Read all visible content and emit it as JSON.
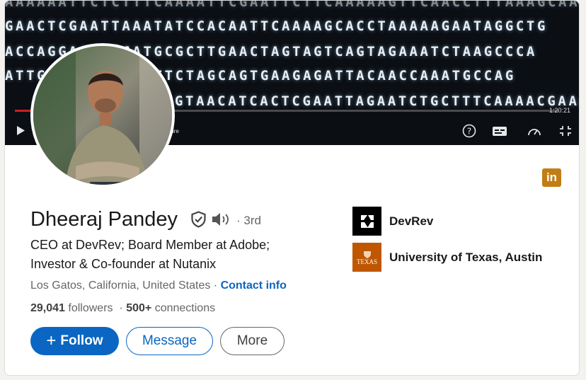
{
  "banner": {
    "dna_rows": [
      "AAAAAATTCTCTTTCAAAATTCGAATTCTTCAAAAAGTTCAACCTTTAAAGCAAAACGGTT",
      "GAACTCGAATTAAATATCCACAATTCAAAAGCACCTAAAAAGAATAGGCTG",
      "ACCAGGAATTTCATGCGCTTGAACTAGTAGTCAGTAGAAATCTAAGCCCA",
      "ATTGCGCTCATTTGTTCTAGCAGTGAAGAGATTACAACCAAATGCCAG",
      "GTAACATCACTCGAATTAGAATCTGCTTTCAAAACGAAAGCTGA"
    ],
    "video": {
      "time": "1:20:21",
      "caption_label": "ture",
      "progress_fraction": 0.06
    }
  },
  "profile": {
    "name": "Dheeraj Pandey",
    "degree": "· 3rd",
    "headline_line1": "CEO at DevRev; Board Member at Adobe;",
    "headline_line2": "Investor & Co-founder at Nutanix",
    "location": "Los Gatos, California, United States",
    "location_sep": " · ",
    "contact_info": "Contact info",
    "followers_count": "29,041",
    "followers_label": "followers",
    "connections_sep": "  · ",
    "connections_count": "500+",
    "connections_label": "connections"
  },
  "actions": {
    "follow_label": "Follow",
    "follow_plus": "+",
    "message_label": "Message",
    "more_label": "More"
  },
  "organizations": [
    {
      "name": "DevRev",
      "icon": "devrev-logo"
    },
    {
      "name": "University of Texas, Austin",
      "icon": "ut-logo",
      "logo_text": "TEXAS"
    }
  ],
  "icons": {
    "verified": "verified-shield-icon",
    "pronunciation": "speaker-icon",
    "linkedin": "linkedin-icon"
  },
  "colors": {
    "primary": "#0a66c2",
    "linkedin_badge": "#c37d16",
    "ut_orange": "#bf5700"
  }
}
